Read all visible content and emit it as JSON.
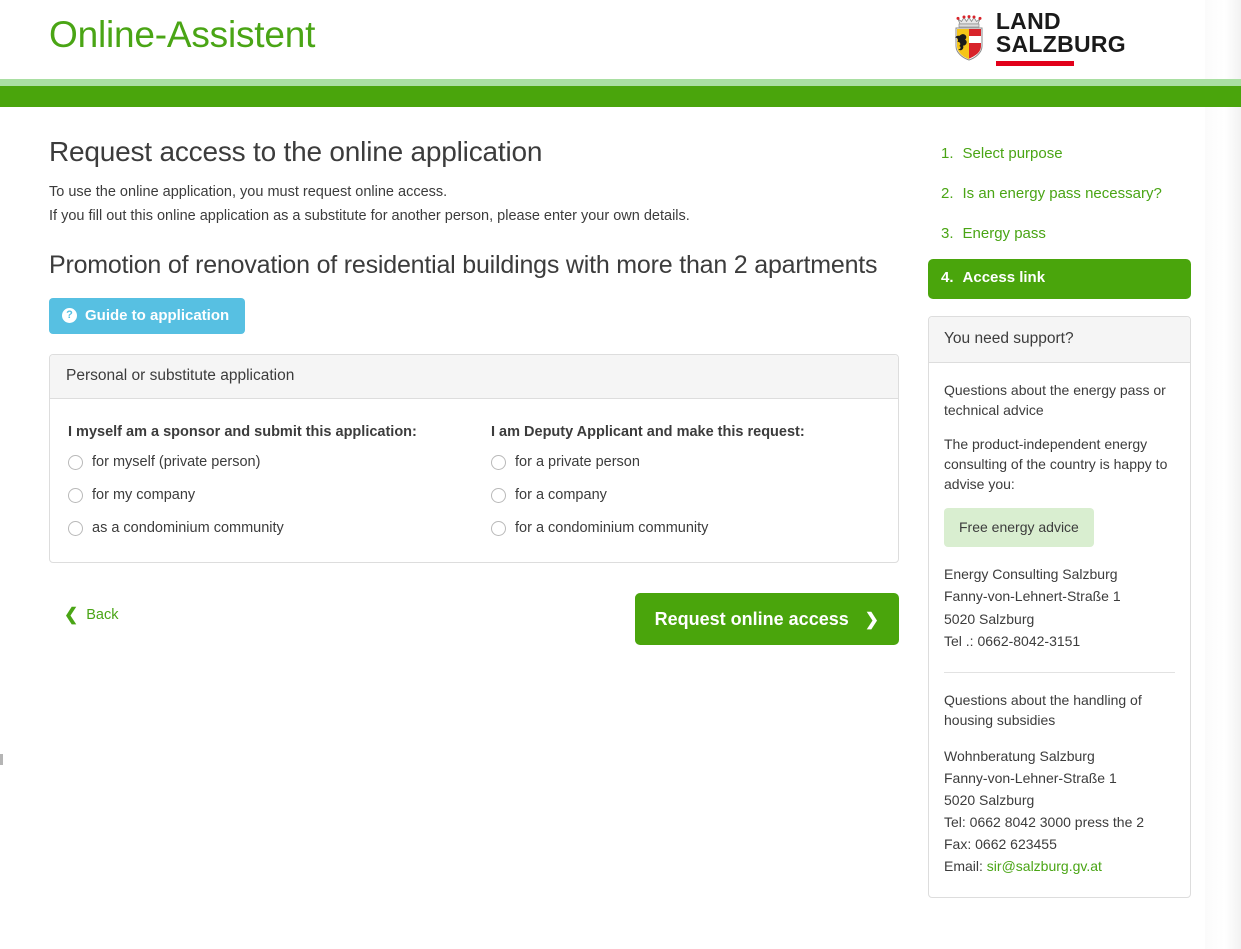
{
  "header": {
    "brand_title": "Online-Assistent",
    "logo": {
      "line1": "LAND",
      "line2": "SALZBURG",
      "crest_name": "land-salzburg-coat-of-arms"
    }
  },
  "main": {
    "page_title": "Request access to the online application",
    "intro_line1": "To use the online application, you must request online access.",
    "intro_line2": "If you fill out this online application as a substitute for another person, please enter your own details.",
    "sub_title": "Promotion of renovation of residential buildings with more than 2 apartments",
    "guide_button": "Guide to application",
    "guide_icon": "question-circle-icon",
    "panel": {
      "heading": "Personal or substitute application",
      "left_group": {
        "legend": "I myself am a sponsor and submit this application:",
        "options": [
          "for myself (private person)",
          "for my company",
          "as a condominium community"
        ]
      },
      "right_group": {
        "legend": "I am Deputy Applicant and make this request:",
        "options": [
          "for a private person",
          "for a company",
          "for a condominium community"
        ]
      }
    },
    "back_label": "Back",
    "back_icon": "chevron-left-icon",
    "submit_label": "Request online access",
    "submit_icon": "chevron-right-icon"
  },
  "sidebar": {
    "steps": [
      {
        "num": "1.",
        "label": "Select purpose",
        "active": false
      },
      {
        "num": "2.",
        "label": "Is an energy pass necessary?",
        "active": false
      },
      {
        "num": "3.",
        "label": "Energy pass",
        "active": false
      },
      {
        "num": "4.",
        "label": "Access link",
        "active": true
      }
    ],
    "support": {
      "heading": "You need support?",
      "para1": "Questions about the energy pass or technical advice",
      "para2": "The product-independent energy consulting of the country is happy to advise you:",
      "advice_button": "Free energy advice",
      "contact1": {
        "name": "Energy Consulting Salzburg",
        "street": "Fanny-von-Lehnert-Straße 1",
        "city": "5020 Salzburg",
        "tel": "Tel .: 0662-8042-3151"
      },
      "para3": "Questions about the handling of housing subsidies",
      "contact2": {
        "name": "Wohnberatung Salzburg",
        "street": "Fanny-von-Lehner-Straße 1",
        "city": "5020 Salzburg",
        "tel": "Tel: 0662 8042 3000 press the 2",
        "fax": "Fax: 0662 623455",
        "email_label": "Email: ",
        "email": "sir@salzburg.gv.at"
      }
    }
  },
  "colors": {
    "brand_green": "#4aa515",
    "band_green": "#4aa50c",
    "band_light_green": "#a9dfa2",
    "guide_blue": "#57c0e2",
    "advice_green": "#d9eed0",
    "logo_red": "#e2001a"
  }
}
